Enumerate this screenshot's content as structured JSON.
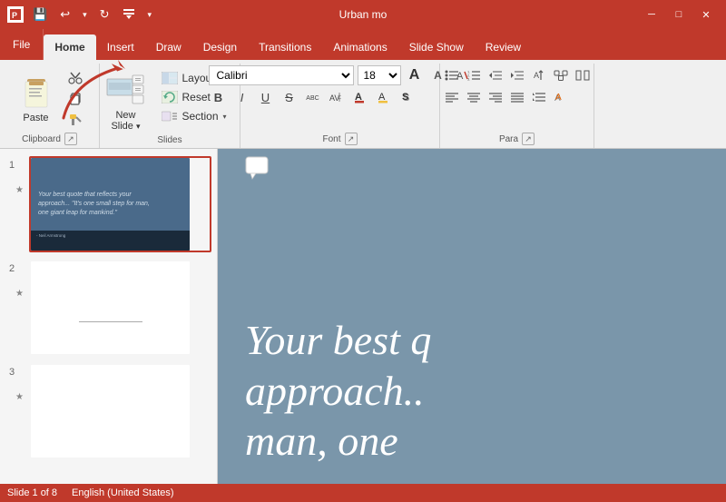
{
  "titleBar": {
    "title": "Urban mo",
    "saveIcon": "💾",
    "undoLabel": "↩",
    "redoLabel": "↻",
    "customizeLabel": "▼"
  },
  "tabs": [
    {
      "id": "file",
      "label": "File",
      "active": false
    },
    {
      "id": "home",
      "label": "Home",
      "active": true
    },
    {
      "id": "insert",
      "label": "Insert",
      "active": false
    },
    {
      "id": "draw",
      "label": "Draw",
      "active": false
    },
    {
      "id": "design",
      "label": "Design",
      "active": false
    },
    {
      "id": "transitions",
      "label": "Transitions",
      "active": false
    },
    {
      "id": "animations",
      "label": "Animations",
      "active": false
    },
    {
      "id": "slideshow",
      "label": "Slide Show",
      "active": false
    },
    {
      "id": "review",
      "label": "Review",
      "active": false
    }
  ],
  "ribbon": {
    "clipboard": {
      "groupLabel": "Clipboard",
      "pasteLabel": "Paste",
      "cutLabel": "Cut",
      "copyLabel": "Copy",
      "formatPainterLabel": "Format Painter"
    },
    "slides": {
      "groupLabel": "Slides",
      "newSlideLabel": "New Slide",
      "layoutLabel": "Layout",
      "resetLabel": "Reset",
      "sectionLabel": "Section",
      "dropdownArrow": "▾"
    },
    "font": {
      "groupLabel": "Font",
      "fontName": "Calibri",
      "fontSize": "18",
      "boldLabel": "B",
      "italicLabel": "I",
      "underlineLabel": "U",
      "strikeLabel": "S",
      "smallCapsLabel": "abc",
      "increaseSizeLabel": "A",
      "decreaseSizeLabel": "A",
      "clearLabel": "A",
      "colorLabel": "A"
    },
    "paragraph": {
      "groupLabel": "Para",
      "bullets": "≡",
      "numbering": "≡",
      "decrease": "←",
      "increase": "→",
      "direction": "↔",
      "alignLeft": "≡",
      "alignCenter": "≡",
      "alignRight": "≡",
      "justify": "≡",
      "columns": "⬜",
      "lineSpacing": "↕"
    }
  },
  "slides": [
    {
      "number": "1",
      "selected": true,
      "quote": "Your best quote that reflects your approach... \"It's one small step for man, one giant leap for mankind.\"",
      "attribution": "- Neil Armstrong"
    },
    {
      "number": "2",
      "selected": false
    },
    {
      "number": "3",
      "selected": false
    }
  ],
  "mainSlide": {
    "text1": "Your best q",
    "text2": "approach..",
    "text3": "man, one"
  },
  "statusBar": {
    "slideCount": "Slide 1 of 8",
    "language": "English (United States)"
  }
}
